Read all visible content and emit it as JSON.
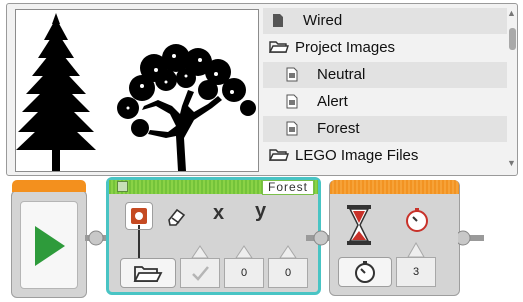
{
  "picker": {
    "items": [
      {
        "label": "Wired",
        "icon": "file-dark-icon"
      },
      {
        "label": "Project Images",
        "icon": "folder-icon"
      },
      {
        "label": "Neutral",
        "icon": "image-file-icon"
      },
      {
        "label": "Alert",
        "icon": "image-file-icon"
      },
      {
        "label": "Forest",
        "icon": "image-file-icon"
      },
      {
        "label": "LEGO Image Files",
        "icon": "folder-icon"
      }
    ]
  },
  "display_block": {
    "file_name": "Forest",
    "x_label": "x",
    "y_label": "y",
    "x_value": "0",
    "y_value": "0"
  },
  "wait_block": {
    "seconds_value": "3"
  },
  "colors": {
    "start_accent": "#f3901e",
    "display_accent": "#8ad246",
    "display_outline": "#49c4c4",
    "wait_accent": "#f29322",
    "play_green": "#2e9b3b"
  }
}
